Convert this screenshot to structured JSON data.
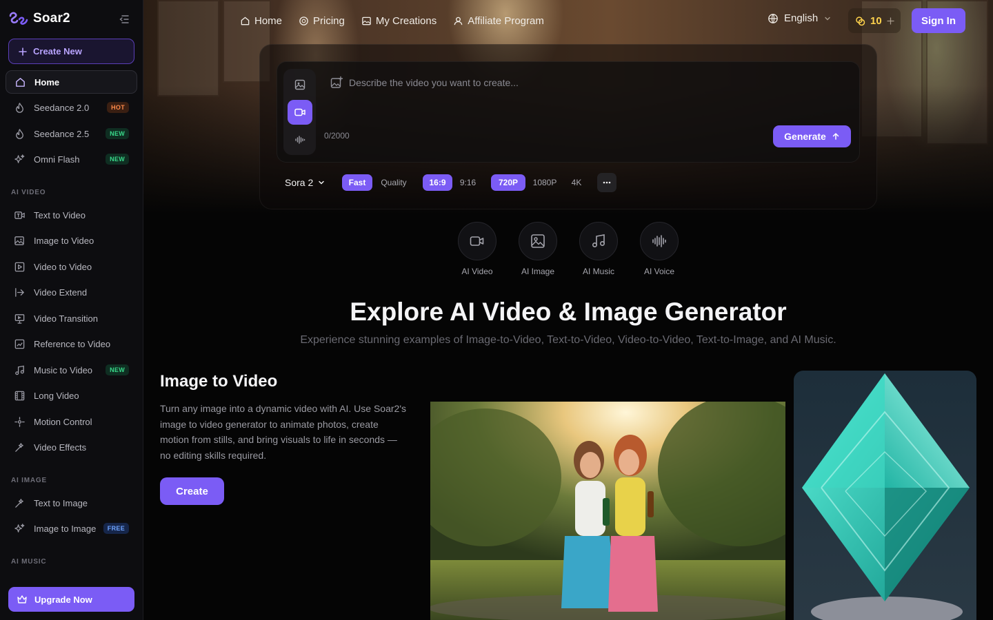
{
  "sidebar": {
    "brand": "Soar2",
    "create_new": "Create New",
    "primary": [
      {
        "label": "Home",
        "icon": "home-icon"
      },
      {
        "label": "Seedance 2.0",
        "icon": "flame-icon",
        "badge": "HOT"
      },
      {
        "label": "Seedance 2.5",
        "icon": "flame-icon",
        "badge": "NEW"
      },
      {
        "label": "Omni Flash",
        "icon": "sparkles-icon",
        "badge": "NEW"
      }
    ],
    "ai_video_label": "AI VIDEO",
    "ai_video": [
      {
        "label": "Text to Video"
      },
      {
        "label": "Image to Video"
      },
      {
        "label": "Video to Video"
      },
      {
        "label": "Video Extend"
      },
      {
        "label": "Video Transition"
      },
      {
        "label": "Reference to Video"
      },
      {
        "label": "Music to Video",
        "badge": "NEW"
      },
      {
        "label": "Long Video"
      },
      {
        "label": "Motion Control"
      },
      {
        "label": "Video Effects"
      }
    ],
    "ai_image_label": "AI IMAGE",
    "ai_image": [
      {
        "label": "Text to Image"
      },
      {
        "label": "Image to Image",
        "badge": "FREE"
      }
    ],
    "ai_music_label": "AI MUSIC",
    "upgrade": "Upgrade Now"
  },
  "topnav": {
    "items": [
      {
        "label": "Home",
        "icon": "home-icon"
      },
      {
        "label": "Pricing",
        "icon": "coin-icon"
      },
      {
        "label": "My Creations",
        "icon": "gallery-icon"
      },
      {
        "label": "Affiliate Program",
        "icon": "user-icon"
      }
    ],
    "language": "English",
    "credits": "10",
    "sign_in": "Sign In"
  },
  "prompt": {
    "placeholder": "Describe the video you want to create...",
    "counter": "0/2000",
    "generate": "Generate",
    "model": "Sora 2",
    "speed": [
      "Fast",
      "Quality"
    ],
    "ratio": [
      "16:9",
      "9:16"
    ],
    "resolution": [
      "720P",
      "1080P",
      "4K"
    ]
  },
  "categories": [
    {
      "label": "AI Video",
      "icon": "video-icon"
    },
    {
      "label": "AI Image",
      "icon": "image-icon"
    },
    {
      "label": "AI Music",
      "icon": "music-icon"
    },
    {
      "label": "AI Voice",
      "icon": "waveform-icon"
    }
  ],
  "heading": {
    "title": "Explore AI Video & Image Generator",
    "subtitle": "Experience stunning examples of Image-to-Video, Text-to-Video, Video-to-Video, Text-to-Image, and AI Music."
  },
  "feature": {
    "title": "Image to Video",
    "description": "Turn any image into a dynamic video with AI. Use Soar2's image to video generator to animate photos, create motion from stills, and bring visuals to life in seconds — no editing skills required.",
    "button": "Create"
  },
  "colors": {
    "accent": "#7b5cf5",
    "hot": "#ff8a4a",
    "new": "#39d98a",
    "free": "#6ea3ff",
    "credits": "#ffd34d"
  }
}
